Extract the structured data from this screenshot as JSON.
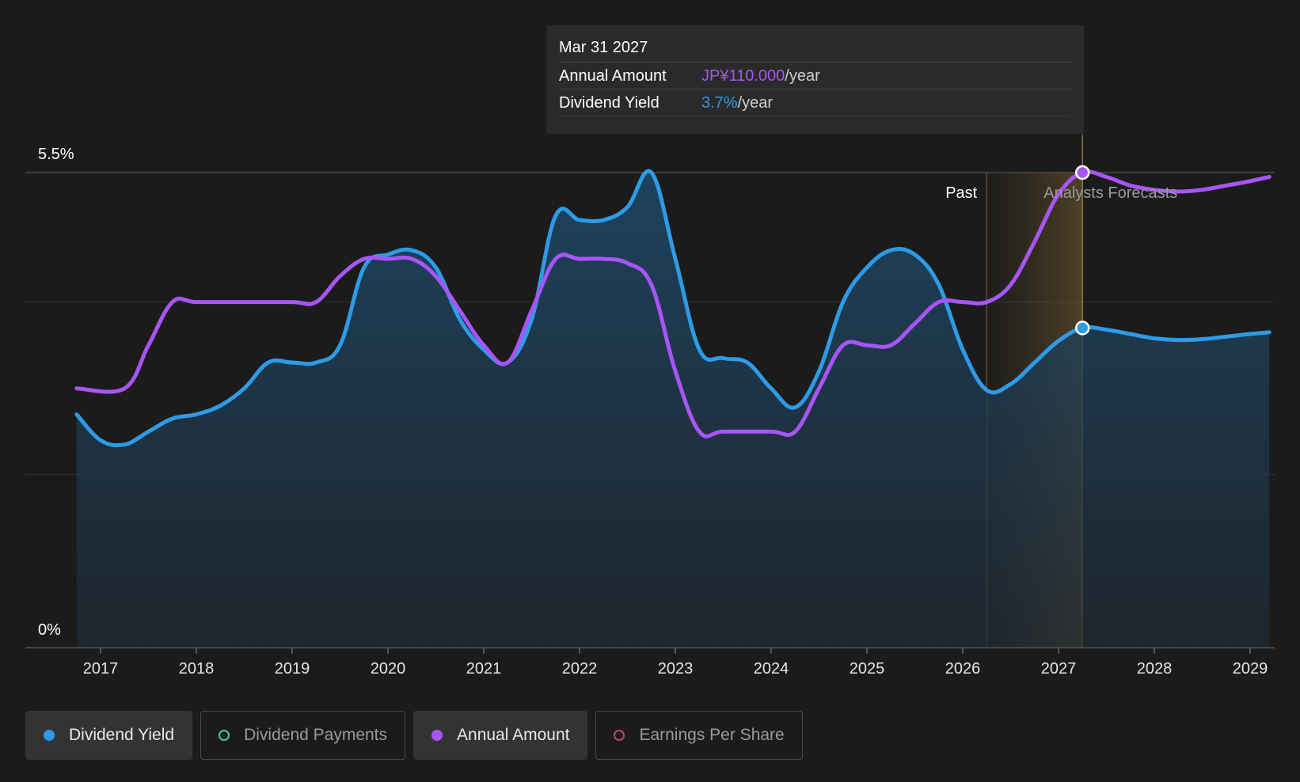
{
  "tooltip": {
    "date": "Mar 31 2027",
    "rows": [
      {
        "label": "Annual Amount",
        "value": "JP¥110.000",
        "unit": "/year",
        "color": "#a855f7"
      },
      {
        "label": "Dividend Yield",
        "value": "3.7%",
        "unit": "/year",
        "color": "#2d9be5"
      }
    ]
  },
  "regions": {
    "past_label": "Past",
    "forecast_label": "Analysts Forecasts"
  },
  "legend": [
    {
      "label": "Dividend Yield",
      "color": "#2d9be5",
      "active": true
    },
    {
      "label": "Dividend Payments",
      "color": "#3fc8b0",
      "active": false
    },
    {
      "label": "Annual Amount",
      "color": "#a855f7",
      "active": true
    },
    {
      "label": "Earnings Per Share",
      "color": "#c0427a",
      "active": false
    }
  ],
  "chart_data": {
    "type": "line",
    "x_ticks": [
      "2017",
      "2018",
      "2019",
      "2020",
      "2021",
      "2022",
      "2023",
      "2024",
      "2025",
      "2026",
      "2027",
      "2028",
      "2029"
    ],
    "y_tick_labels": [
      "0%",
      "5.5%"
    ],
    "ylim": [
      0,
      5.5
    ],
    "xlim": [
      2016.5,
      2029.2
    ],
    "grid": true,
    "past_forecast_boundary": 2026.25,
    "hover_x": 2027.25,
    "series": [
      {
        "name": "Dividend Yield",
        "color": "#2d9be5",
        "area": true,
        "points": [
          [
            2016.75,
            2.7
          ],
          [
            2017.0,
            2.4
          ],
          [
            2017.25,
            2.35
          ],
          [
            2017.5,
            2.5
          ],
          [
            2017.75,
            2.65
          ],
          [
            2018.0,
            2.7
          ],
          [
            2018.25,
            2.8
          ],
          [
            2018.5,
            3.0
          ],
          [
            2018.75,
            3.3
          ],
          [
            2019.0,
            3.3
          ],
          [
            2019.25,
            3.3
          ],
          [
            2019.5,
            3.5
          ],
          [
            2019.75,
            4.4
          ],
          [
            2020.0,
            4.55
          ],
          [
            2020.25,
            4.6
          ],
          [
            2020.5,
            4.4
          ],
          [
            2020.75,
            3.8
          ],
          [
            2021.0,
            3.45
          ],
          [
            2021.25,
            3.3
          ],
          [
            2021.5,
            3.8
          ],
          [
            2021.75,
            5.0
          ],
          [
            2022.0,
            4.95
          ],
          [
            2022.25,
            4.95
          ],
          [
            2022.5,
            5.1
          ],
          [
            2022.75,
            5.5
          ],
          [
            2023.0,
            4.5
          ],
          [
            2023.25,
            3.45
          ],
          [
            2023.5,
            3.35
          ],
          [
            2023.75,
            3.3
          ],
          [
            2024.0,
            3.0
          ],
          [
            2024.25,
            2.78
          ],
          [
            2024.5,
            3.2
          ],
          [
            2024.75,
            4.0
          ],
          [
            2025.0,
            4.4
          ],
          [
            2025.25,
            4.6
          ],
          [
            2025.5,
            4.55
          ],
          [
            2025.75,
            4.2
          ],
          [
            2026.0,
            3.45
          ],
          [
            2026.25,
            2.98
          ],
          [
            2026.5,
            3.05
          ],
          [
            2026.75,
            3.3
          ],
          [
            2027.0,
            3.55
          ],
          [
            2027.25,
            3.7
          ],
          [
            2027.5,
            3.68
          ],
          [
            2027.75,
            3.63
          ],
          [
            2028.0,
            3.58
          ],
          [
            2028.25,
            3.56
          ],
          [
            2028.5,
            3.57
          ],
          [
            2028.75,
            3.6
          ],
          [
            2029.0,
            3.63
          ],
          [
            2029.2,
            3.65
          ]
        ]
      },
      {
        "name": "Annual Amount",
        "color": "#a855f7",
        "area": false,
        "points": [
          [
            2016.75,
            3.0
          ],
          [
            2017.25,
            3.0
          ],
          [
            2017.5,
            3.5
          ],
          [
            2017.75,
            4.0
          ],
          [
            2018.0,
            4.0
          ],
          [
            2018.5,
            4.0
          ],
          [
            2019.0,
            4.0
          ],
          [
            2019.25,
            4.0
          ],
          [
            2019.5,
            4.3
          ],
          [
            2019.75,
            4.5
          ],
          [
            2020.0,
            4.5
          ],
          [
            2020.25,
            4.5
          ],
          [
            2020.5,
            4.3
          ],
          [
            2020.75,
            3.9
          ],
          [
            2021.0,
            3.5
          ],
          [
            2021.25,
            3.3
          ],
          [
            2021.5,
            3.9
          ],
          [
            2021.75,
            4.5
          ],
          [
            2022.0,
            4.5
          ],
          [
            2022.25,
            4.5
          ],
          [
            2022.5,
            4.45
          ],
          [
            2022.75,
            4.2
          ],
          [
            2023.0,
            3.2
          ],
          [
            2023.25,
            2.5
          ],
          [
            2023.5,
            2.5
          ],
          [
            2024.0,
            2.5
          ],
          [
            2024.25,
            2.5
          ],
          [
            2024.5,
            3.0
          ],
          [
            2024.75,
            3.5
          ],
          [
            2025.0,
            3.5
          ],
          [
            2025.25,
            3.5
          ],
          [
            2025.5,
            3.75
          ],
          [
            2025.75,
            4.0
          ],
          [
            2026.0,
            4.0
          ],
          [
            2026.25,
            4.0
          ],
          [
            2026.5,
            4.2
          ],
          [
            2026.75,
            4.7
          ],
          [
            2027.0,
            5.25
          ],
          [
            2027.25,
            5.5
          ],
          [
            2027.5,
            5.45
          ],
          [
            2027.75,
            5.35
          ],
          [
            2028.0,
            5.3
          ],
          [
            2028.25,
            5.28
          ],
          [
            2028.5,
            5.3
          ],
          [
            2028.75,
            5.35
          ],
          [
            2029.0,
            5.4
          ],
          [
            2029.2,
            5.45
          ]
        ]
      }
    ]
  }
}
